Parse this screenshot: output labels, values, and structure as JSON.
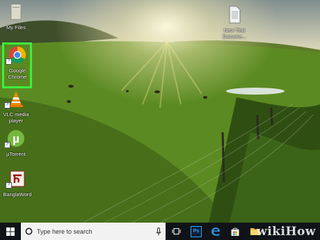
{
  "desktop": {
    "icons": [
      {
        "name": "my-files",
        "label": "My Files"
      },
      {
        "name": "new-text-document",
        "label": "New Text Docume..."
      },
      {
        "name": "google-chrome",
        "label": "Google Chrome",
        "selected": true
      },
      {
        "name": "vlc-media-player",
        "label": "VLC media player"
      },
      {
        "name": "utorrent",
        "label": "µTorrent"
      },
      {
        "name": "banglaword",
        "label": "BanglaWord"
      }
    ],
    "highlight_color": "#3df03d"
  },
  "taskbar": {
    "search_placeholder": "Type here to search",
    "pinned": [
      "start-icon",
      "cortana-icon",
      "mic-icon",
      "task-view-icon",
      "photoshop-icon",
      "edge-icon",
      "store-icon",
      "explorer-icon"
    ],
    "photoshop_label": "Ps"
  },
  "watermark": "wikiHow"
}
